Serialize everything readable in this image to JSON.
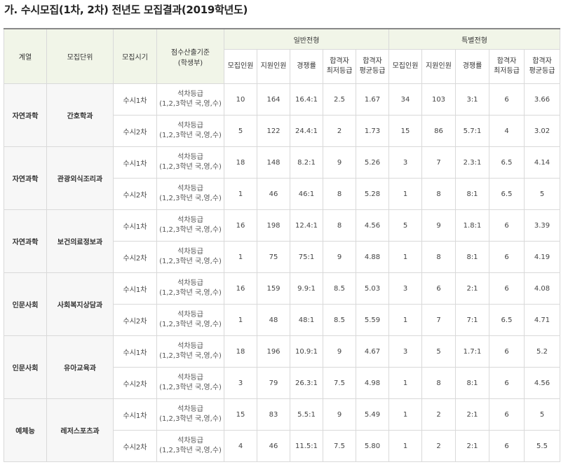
{
  "title": "가. 수시모집(1차, 2차) 전년도 모집결과(2019학년도)",
  "headers": {
    "field": "계열",
    "unit": "모집단위",
    "period": "모집시기",
    "basis_line1": "점수산출기준",
    "basis_line2": "(학생부)",
    "general": "일반전형",
    "special": "특별전형",
    "recruit": "모집인원",
    "applicants": "지원인원",
    "ratio": "경쟁률",
    "min_grade_1": "합격자",
    "min_grade_2": "최저등급",
    "avg_grade_1": "합격자",
    "avg_grade_2": "평균등급"
  },
  "basis": {
    "line1": "석차등급",
    "line2": "(1,2,3학년 국,영,수)"
  },
  "groups": [
    {
      "field": "자연과학",
      "unit": "간호학과",
      "rows": [
        {
          "period": "수시1차",
          "g": [
            "10",
            "164",
            "16.4:1",
            "2.5",
            "1.67"
          ],
          "s": [
            "34",
            "103",
            "3:1",
            "6",
            "3.66"
          ]
        },
        {
          "period": "수시2차",
          "g": [
            "5",
            "122",
            "24.4:1",
            "2",
            "1.73"
          ],
          "s": [
            "15",
            "86",
            "5.7:1",
            "4",
            "3.02"
          ]
        }
      ]
    },
    {
      "field": "자연과학",
      "unit": "관광외식조리과",
      "rows": [
        {
          "period": "수시1차",
          "g": [
            "18",
            "148",
            "8.2:1",
            "9",
            "5.26"
          ],
          "s": [
            "3",
            "7",
            "2.3:1",
            "6.5",
            "4.14"
          ]
        },
        {
          "period": "수시2차",
          "g": [
            "1",
            "46",
            "46:1",
            "8",
            "5.28"
          ],
          "s": [
            "1",
            "8",
            "8:1",
            "6.5",
            "5"
          ]
        }
      ]
    },
    {
      "field": "자연과학",
      "unit": "보건의료정보과",
      "rows": [
        {
          "period": "수시1차",
          "g": [
            "16",
            "198",
            "12.4:1",
            "8",
            "4.56"
          ],
          "s": [
            "5",
            "9",
            "1.8:1",
            "6",
            "3.39"
          ]
        },
        {
          "period": "수시2차",
          "g": [
            "1",
            "75",
            "75:1",
            "9",
            "4.88"
          ],
          "s": [
            "1",
            "8",
            "8:1",
            "6",
            "4.19"
          ]
        }
      ]
    },
    {
      "field": "인문사회",
      "unit": "사회복지상담과",
      "rows": [
        {
          "period": "수시1차",
          "g": [
            "16",
            "159",
            "9.9:1",
            "8.5",
            "5.03"
          ],
          "s": [
            "3",
            "6",
            "2:1",
            "6",
            "4.08"
          ]
        },
        {
          "period": "수시2차",
          "g": [
            "1",
            "48",
            "48:1",
            "8.5",
            "5.59"
          ],
          "s": [
            "1",
            "7",
            "7:1",
            "6.5",
            "4.71"
          ]
        }
      ]
    },
    {
      "field": "인문사회",
      "unit": "유아교육과",
      "rows": [
        {
          "period": "수시1차",
          "g": [
            "18",
            "196",
            "10.9:1",
            "9",
            "4.67"
          ],
          "s": [
            "3",
            "5",
            "1.7:1",
            "6",
            "5.2"
          ]
        },
        {
          "period": "수시2차",
          "g": [
            "3",
            "79",
            "26.3:1",
            "7.5",
            "4.98"
          ],
          "s": [
            "1",
            "8",
            "8:1",
            "6",
            "4.56"
          ]
        }
      ]
    },
    {
      "field": "예체능",
      "unit": "레저스포츠과",
      "rows": [
        {
          "period": "수시1차",
          "g": [
            "15",
            "83",
            "5.5:1",
            "9",
            "5.49"
          ],
          "s": [
            "1",
            "2",
            "2:1",
            "6",
            "5"
          ]
        },
        {
          "period": "수시2차",
          "g": [
            "4",
            "46",
            "11.5:1",
            "7.5",
            "5.80"
          ],
          "s": [
            "1",
            "2",
            "2:1",
            "6",
            "5.5"
          ]
        }
      ]
    }
  ]
}
